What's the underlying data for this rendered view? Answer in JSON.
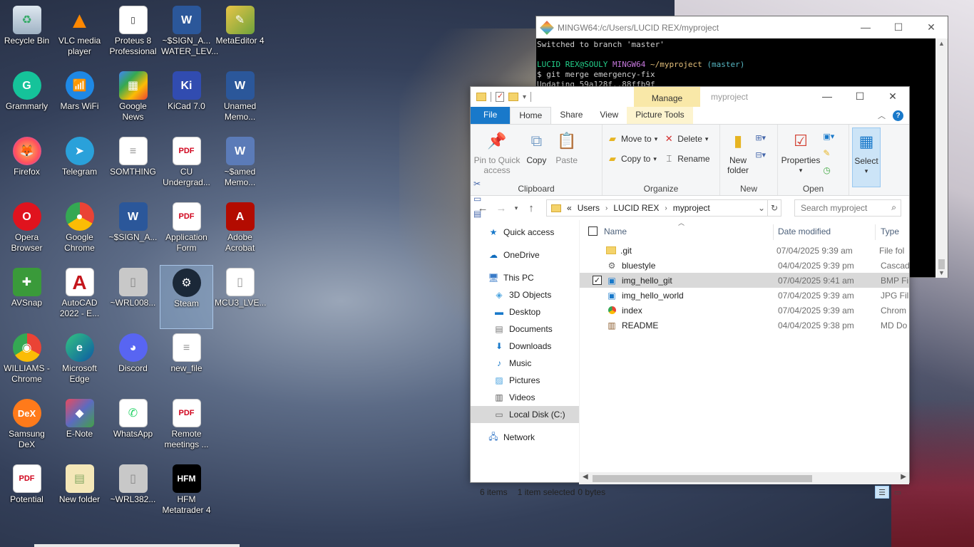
{
  "desktop": {
    "icons": [
      {
        "label": "Recycle Bin"
      },
      {
        "label": "VLC media player"
      },
      {
        "label": "Proteus 8 Professional"
      },
      {
        "label": "~$SIGN_A... WATER_LEV..."
      },
      {
        "label": "MetaEditor 4"
      },
      {
        "label": "Grammarly"
      },
      {
        "label": "Mars WiFi"
      },
      {
        "label": "Google News"
      },
      {
        "label": "KiCad 7.0"
      },
      {
        "label": "Unamed Memo..."
      },
      {
        "label": "Firefox"
      },
      {
        "label": "Telegram"
      },
      {
        "label": "SOMTHING"
      },
      {
        "label": "CU Undergrad..."
      },
      {
        "label": "~$amed Memo..."
      },
      {
        "label": "Opera Browser"
      },
      {
        "label": "Google Chrome"
      },
      {
        "label": "~$SIGN_A..."
      },
      {
        "label": "Application Form"
      },
      {
        "label": "Adobe Acrobat"
      },
      {
        "label": "AVSnap"
      },
      {
        "label": "AutoCAD 2022 - E..."
      },
      {
        "label": "~WRL008..."
      },
      {
        "label": "Steam"
      },
      {
        "label": "MCU3_LVE..."
      },
      {
        "label": "WILLIAMS - Chrome"
      },
      {
        "label": "Microsoft Edge"
      },
      {
        "label": "Discord"
      },
      {
        "label": "new_file"
      },
      {
        "label": "Samsung DeX"
      },
      {
        "label": "E-Note"
      },
      {
        "label": "WhatsApp"
      },
      {
        "label": "Remote meetings ..."
      },
      {
        "label": "Potential"
      },
      {
        "label": "New folder"
      },
      {
        "label": "~WRL382..."
      },
      {
        "label": "HFM Metatrader 4"
      }
    ]
  },
  "bash": {
    "title": "MINGW64:/c/Users/LUCID REX/myproject",
    "lines": {
      "l1": "Switched to branch 'master'",
      "prompt_user": "LUCID REX@SOULY",
      "prompt_env": "MINGW64",
      "prompt_path": "~/myproject",
      "prompt_branch": "(master)",
      "cmd": "$ git merge emergency-fix",
      "l3": "Updating 59a128f..88ffb9f"
    }
  },
  "explorer": {
    "window_title": "myproject",
    "manage_label": "Manage",
    "tabs": {
      "file": "File",
      "home": "Home",
      "share": "Share",
      "view": "View",
      "picture_tools": "Picture Tools"
    },
    "ribbon": {
      "clipboard": {
        "pin": "Pin to Quick access",
        "copy": "Copy",
        "paste": "Paste",
        "group": "Clipboard"
      },
      "organize": {
        "move_to": "Move to",
        "copy_to": "Copy to",
        "delete": "Delete",
        "rename": "Rename",
        "group": "Organize"
      },
      "new": {
        "new_folder": "New folder",
        "group": "New"
      },
      "open": {
        "properties": "Properties",
        "group": "Open"
      },
      "select": {
        "select": "Select"
      }
    },
    "address": {
      "overflow": "«",
      "crumbs": [
        "Users",
        "LUCID REX",
        "myproject"
      ]
    },
    "search": {
      "placeholder": "Search myproject"
    },
    "nav": {
      "quick_access": "Quick access",
      "onedrive": "OneDrive",
      "this_pc": "This PC",
      "objects3d": "3D Objects",
      "desktop": "Desktop",
      "documents": "Documents",
      "downloads": "Downloads",
      "music": "Music",
      "pictures": "Pictures",
      "videos": "Videos",
      "local_disk": "Local Disk (C:)",
      "network": "Network"
    },
    "columns": {
      "name": "Name",
      "date": "Date modified",
      "type": "Type"
    },
    "files": [
      {
        "name": ".git",
        "date": "07/04/2025 9:39 am",
        "type": "File fol",
        "icon": "folder-icon"
      },
      {
        "name": "bluestyle",
        "date": "04/04/2025 9:39 pm",
        "type": "Cascad",
        "icon": "css-file-icon"
      },
      {
        "name": "img_hello_git",
        "date": "07/04/2025 9:41 am",
        "type": "BMP Fi",
        "icon": "image-file-icon",
        "selected": true
      },
      {
        "name": "img_hello_world",
        "date": "07/04/2025 9:39 am",
        "type": "JPG Fil",
        "icon": "image-file-icon"
      },
      {
        "name": "index",
        "date": "07/04/2025 9:39 am",
        "type": "Chrom",
        "icon": "chrome-html-icon"
      },
      {
        "name": "README",
        "date": "04/04/2025 9:38 pm",
        "type": "MD Do",
        "icon": "md-file-icon"
      }
    ],
    "status": {
      "items": "6 items",
      "selected": "1 item selected",
      "size": "0 bytes"
    }
  }
}
